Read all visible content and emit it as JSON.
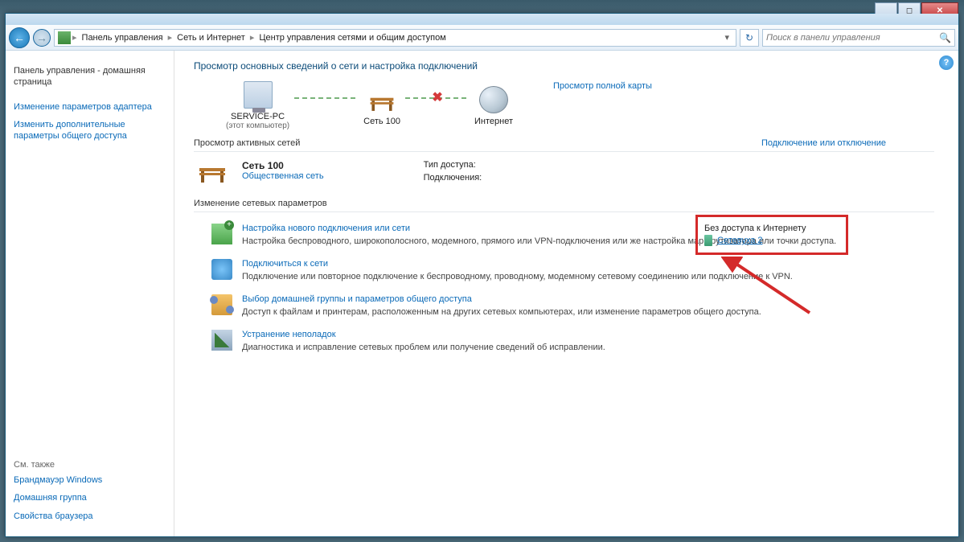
{
  "window_controls": {
    "min": "_",
    "max": "◻",
    "close": "✕"
  },
  "breadcrumb": {
    "items": [
      "Панель управления",
      "Сеть и Интернет",
      "Центр управления сетями и общим доступом"
    ]
  },
  "search": {
    "placeholder": "Поиск в панели управления"
  },
  "sidebar": {
    "home": "Панель управления - домашняя страница",
    "links": [
      "Изменение параметров адаптера",
      "Изменить дополнительные параметры общего доступа"
    ],
    "see_also_label": "См. также",
    "see_also": [
      "Брандмауэр Windows",
      "Домашняя группа",
      "Свойства браузера"
    ]
  },
  "content": {
    "title": "Просмотр основных сведений о сети и настройка подключений",
    "full_map_link": "Просмотр полной карты",
    "map": {
      "pc_name": "SERVICE-PC",
      "pc_sub": "(этот компьютер)",
      "net_name": "Сеть 100",
      "internet": "Интернет"
    },
    "active_header": "Просмотр активных сетей",
    "connect_link": "Подключение или отключение",
    "active": {
      "name": "Сеть 100",
      "type": "Общественная сеть",
      "access_label": "Тип доступа:",
      "access_value": "Без доступа к Интернету",
      "conn_label": "Подключения:",
      "conn_value": "Сетевуха 2"
    },
    "change_header": "Изменение сетевых параметров",
    "tasks": [
      {
        "title": "Настройка нового подключения или сети",
        "desc": "Настройка беспроводного, широкополосного, модемного, прямого или VPN-подключения или же настройка маршрутизатора или точки доступа."
      },
      {
        "title": "Подключиться к сети",
        "desc": "Подключение или повторное подключение к беспроводному, проводному, модемному сетевому соединению или подключение к VPN."
      },
      {
        "title": "Выбор домашней группы и параметров общего доступа",
        "desc": "Доступ к файлам и принтерам, расположенным на других сетевых компьютерах, или изменение параметров общего доступа."
      },
      {
        "title": "Устранение неполадок",
        "desc": "Диагностика и исправление сетевых проблем или получение сведений об исправлении."
      }
    ]
  }
}
